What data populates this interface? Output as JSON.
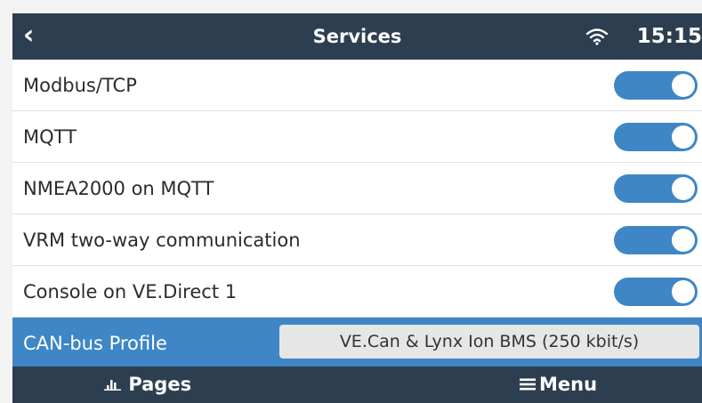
{
  "header": {
    "title": "Services",
    "back_icon": "chevron-left-icon",
    "wifi_icon": "wifi-icon",
    "time": "15:15"
  },
  "services": [
    {
      "label": "Modbus/TCP",
      "enabled": true
    },
    {
      "label": "MQTT",
      "enabled": true
    },
    {
      "label": "NMEA2000 on MQTT",
      "enabled": true
    },
    {
      "label": "VRM two-way communication",
      "enabled": true
    },
    {
      "label": "Console on VE.Direct 1",
      "enabled": true
    }
  ],
  "can_profile": {
    "label": "CAN-bus Profile",
    "value": "VE.Can & Lynx Ion BMS (250 kbit/s)"
  },
  "footer": {
    "pages_label": "Pages",
    "menu_label": "Menu"
  },
  "colors": {
    "bar": "#2d3e50",
    "accent": "#3e86c5"
  }
}
